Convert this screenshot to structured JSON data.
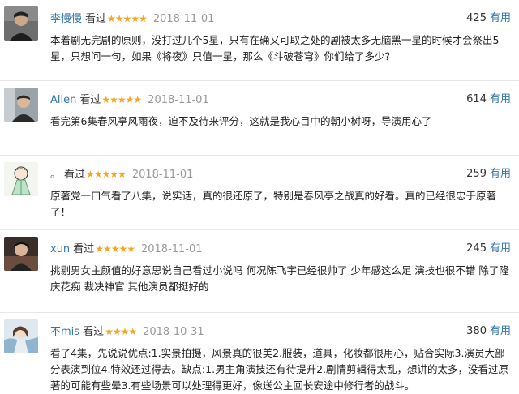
{
  "reviews": [
    {
      "author": "李慢慢",
      "watched": "看过",
      "stars": "★★★★★",
      "date": "2018-11-01",
      "useful_count": "425",
      "useful_label": "有用",
      "avatar_icon": "person-portrait-icon",
      "content": "本着剧无完剧的原则，没打过几个5星，只有在确又可取之处的剧被太多无脑黑一星的时候才会祭出5星，只想问一句，如果《将夜》只值一星，那么《斗破苍穹》你们给了多少？"
    },
    {
      "author": "Allen",
      "watched": "看过",
      "stars": "★★★★★",
      "date": "2018-11-01",
      "useful_count": "614",
      "useful_label": "有用",
      "avatar_icon": "person-portrait-icon",
      "content": "看完第6集春风亭风雨夜，迫不及待来评分，这就是我心目中的朝小树呀，导演用心了"
    },
    {
      "author": "。",
      "watched": "看过",
      "stars": "★★★★★",
      "date": "2018-11-01",
      "useful_count": "259",
      "useful_label": "有用",
      "avatar_icon": "cartoon-character-icon",
      "content": "原著党一口气看了八集，说实话，真的很还原了，特别是春风亭之战真的好看。真的已经很忠于原著了！"
    },
    {
      "author": "xun",
      "watched": "看过",
      "stars": "★★★★★",
      "date": "2018-11-01",
      "useful_count": "245",
      "useful_label": "有用",
      "avatar_icon": "person-portrait-icon",
      "content": "挑剔男女主颜值的好意思说自己看过小说吗 何况陈飞宇已经很帅了 少年感这么足 演技也很不错 除了隆庆花痴 裁决神官 其他演员都挺好的"
    },
    {
      "author": "不mis",
      "watched": "看过",
      "stars": "★★★★",
      "date": "2018-10-31",
      "useful_count": "380",
      "useful_label": "有用",
      "avatar_icon": "anime-character-icon",
      "content": "看了4集，先说说优点:1.实景拍摄，风景真的很美2.服装，道具，化妆都很用心，贴合实际3.演员大部分表演到位4.特效还过得去。缺点:1.男主角演技还有待提升2.剧情剪辑得太乱，想讲的太多，没看过原著的可能有些晕3.有些场景可以处理得更好，像送公主回长安途中修行者的战斗。"
    }
  ],
  "colors": {
    "link": "#3377aa",
    "star": "#f5a623",
    "date": "#999999"
  }
}
